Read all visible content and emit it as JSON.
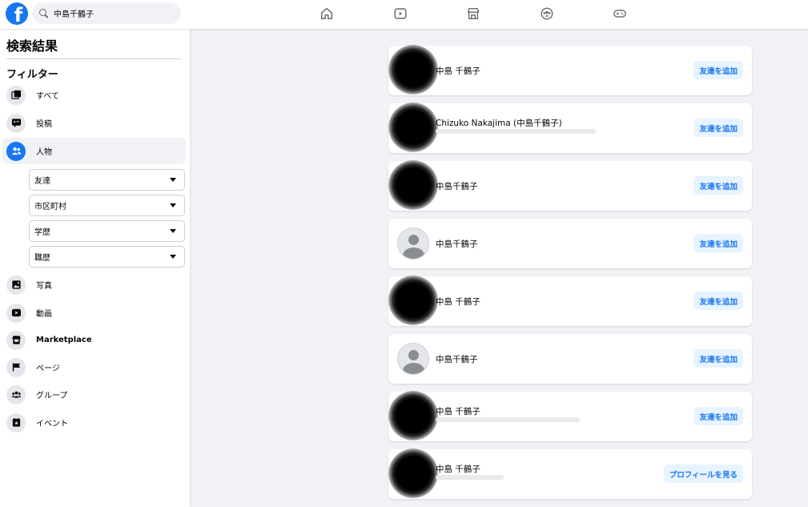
{
  "search": {
    "value": "中島千鶴子"
  },
  "nav": {
    "icons": [
      "home-icon",
      "video-icon",
      "marketplace-icon",
      "groups-icon",
      "gaming-icon"
    ]
  },
  "sidebar": {
    "title": "検索結果",
    "filter_title": "フィルター",
    "items": [
      {
        "label": "すべて",
        "icon": "all-icon"
      },
      {
        "label": "投稿",
        "icon": "posts-icon"
      },
      {
        "label": "人物",
        "icon": "people-icon",
        "active": true
      },
      {
        "label": "写真",
        "icon": "photos-icon"
      },
      {
        "label": "動画",
        "icon": "video-icon"
      },
      {
        "label": "Marketplace",
        "icon": "marketplace-icon"
      },
      {
        "label": "ページ",
        "icon": "flag-icon"
      },
      {
        "label": "グループ",
        "icon": "groups-icon"
      },
      {
        "label": "イベント",
        "icon": "event-icon"
      }
    ],
    "people_filters": [
      {
        "label": "友達"
      },
      {
        "label": "市区町村"
      },
      {
        "label": "学歴"
      },
      {
        "label": "職歴"
      }
    ]
  },
  "results": [
    {
      "name": "中島 千鶴子",
      "button": "友達を追加",
      "avatar": "blurred"
    },
    {
      "name": "Chizuko Nakajima (中島千鶴子)",
      "button": "友達を追加",
      "avatar": "blurred"
    },
    {
      "name": "中島千鶴子",
      "button": "友達を追加",
      "avatar": "blurred"
    },
    {
      "name": "中島千鶴子",
      "button": "友達を追加",
      "avatar": "default"
    },
    {
      "name": "中島 千鶴子",
      "button": "友達を追加",
      "avatar": "blurred"
    },
    {
      "name": "中島千鶴子",
      "button": "友達を追加",
      "avatar": "default"
    },
    {
      "name": "中島 千鶴子",
      "button": "友達を追加",
      "avatar": "blurred"
    },
    {
      "name": "中島 千鶴子",
      "button": "プロフィールを見る",
      "avatar": "blurred"
    }
  ],
  "colors": {
    "brand": "#1877f2",
    "background": "#f0f2f5",
    "button_bg": "#e7f3ff"
  }
}
